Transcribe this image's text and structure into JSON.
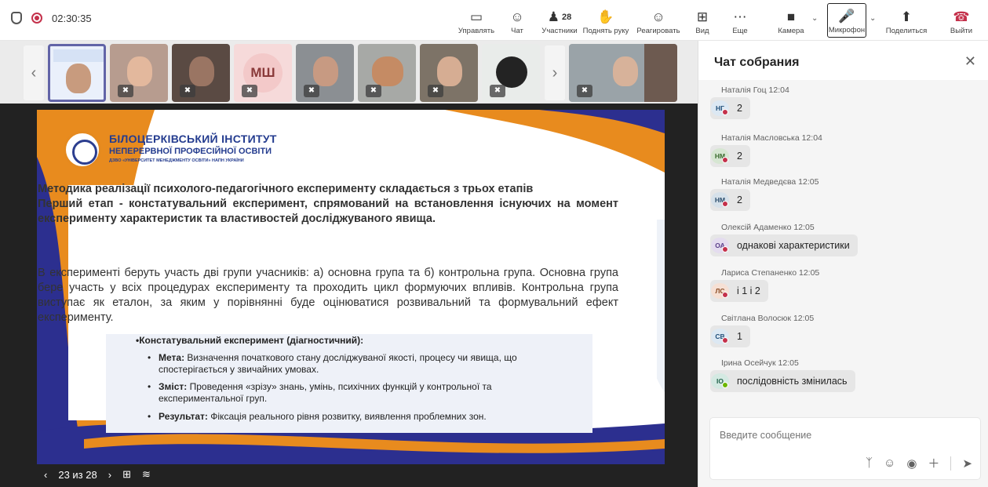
{
  "topbar": {
    "timer": "02:30:35",
    "buttons": [
      {
        "label": "Управлять",
        "icon": "share-screen-icon"
      },
      {
        "label": "Чат",
        "icon": "chat-icon"
      },
      {
        "label": "Участники",
        "icon": "people-icon",
        "count": "28"
      },
      {
        "label": "Поднять руку",
        "icon": "raise-hand-icon"
      },
      {
        "label": "Реагировать",
        "icon": "smile-icon"
      },
      {
        "label": "Вид",
        "icon": "grid-icon"
      },
      {
        "label": "Еще",
        "icon": "more-icon"
      },
      {
        "label": "Камера",
        "icon": "camera-icon"
      },
      {
        "label": "Микрофон",
        "icon": "mic-off-icon"
      },
      {
        "label": "Поделиться",
        "icon": "share-icon"
      },
      {
        "label": "Выйти",
        "icon": "phone-hangup-icon"
      }
    ],
    "leave_color": "#c4314b"
  },
  "video_strip": {
    "ms_initials": "МШ"
  },
  "slide": {
    "logo_title": "БІЛОЦЕРКІВСЬКИЙ ІНСТИТУТ",
    "logo_subtitle": "НЕПЕРЕРВНОЇ ПРОФЕСІЙНОЇ ОСВІТИ",
    "logo_caption": "ДЗВО «УНІВЕРСИТЕТ МЕНЕДЖМЕНТУ ОСВІТИ» НАПН УКРАЇНИ",
    "heading": "Методика реалізації психолого-педагогічного експерименту складається з трьох етапів",
    "stage1": "Перший етап - констатувальний експеримент, спрямований на встановлення існуючих на момент експерименту характеристик та властивостей досліджуваного явища.",
    "body": "В експерименті беруть участь дві групи учасників: а) основна група та б) контрольна група. Основна група бере участь у всіх процедурах експерименту та проходить цикл формуючих впливів. Контрольна група виступає як еталон, за яким у порівнянні буде оцінюватися розвивальний та формувальний ефект експерименту.",
    "subheading": "•Констатувальний експеримент (діагностичний):",
    "bullets": [
      {
        "term": "Мета:",
        "text": " Визначення початкового стану досліджуваної якості, процесу чи явища, що спостерігається у звичайних умовах."
      },
      {
        "term": "Зміст:",
        "text": " Проведення «зрізу» знань, умінь, психічних функцій у контрольної та експериментальної груп."
      },
      {
        "term": "Результат:",
        "text": " Фіксація реального рівня розвитку, виявлення проблемних зон."
      }
    ],
    "page_counter": "23 из 28"
  },
  "chat": {
    "title": "Чат собрания",
    "messages": [
      {
        "author": "Наталія Гоц",
        "time": "12:04",
        "initials": "НГ",
        "text": "2",
        "status": "#c4314b",
        "avatar_bg": "#dce8f3",
        "avatar_fg": "#1f4e79"
      },
      {
        "author": "Наталія Масловська",
        "time": "12:04",
        "initials": "НМ",
        "text": "2",
        "status": "#c4314b",
        "avatar_bg": "#d6e6d2",
        "avatar_fg": "#3a6b2e"
      },
      {
        "author": "Наталія Медведєва",
        "time": "12:05",
        "initials": "НМ",
        "text": "2",
        "status": "#c4314b",
        "avatar_bg": "#d6e1ea",
        "avatar_fg": "#2d4f6e"
      },
      {
        "author": "Олексій Адаменко",
        "time": "12:05",
        "initials": "ОА",
        "text": "однакові характеристики",
        "status": "#c4314b",
        "avatar_bg": "#e4dcef",
        "avatar_fg": "#5a3f8a"
      },
      {
        "author": "Лариса Степаненко",
        "time": "12:05",
        "initials": "ЛС",
        "text": "і 1 і 2",
        "status": "#c4314b",
        "avatar_bg": "#f6e0d4",
        "avatar_fg": "#8a4a22"
      },
      {
        "author": "Світлана Волосюк",
        "time": "12:05",
        "initials": "СВ",
        "text": "1",
        "status": "#c4314b",
        "avatar_bg": "#dce8f3",
        "avatar_fg": "#1f4e79"
      },
      {
        "author": "Ірина Осейчук",
        "time": "12:05",
        "initials": "ІО",
        "text": "послідовність змінилась",
        "status": "#6bb700",
        "avatar_bg": "#d4e9e2",
        "avatar_fg": "#22634c"
      }
    ],
    "compose_placeholder": "Введите сообщение"
  }
}
